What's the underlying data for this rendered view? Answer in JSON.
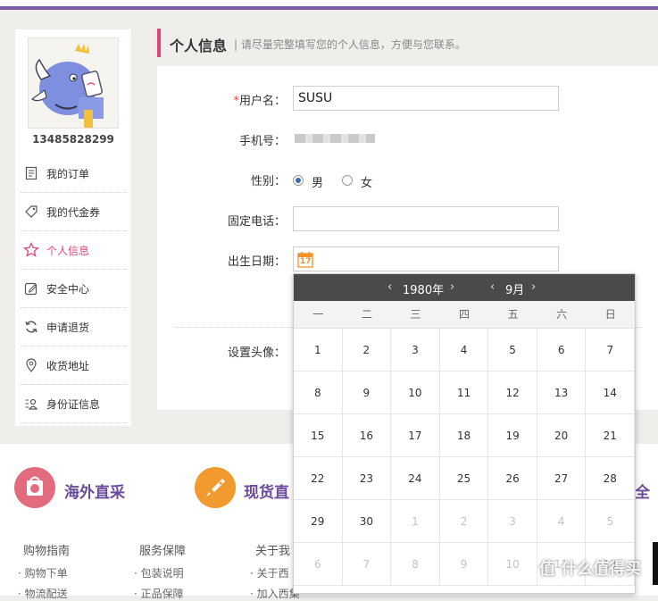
{
  "profile": {
    "phone": "13485828299"
  },
  "sidebar": {
    "items": [
      {
        "label": "我的订单",
        "icon": "order-icon"
      },
      {
        "label": "我的代金券",
        "icon": "coupon-icon"
      },
      {
        "label": "个人信息",
        "icon": "star-icon",
        "active": true
      },
      {
        "label": "安全中心",
        "icon": "edit-icon"
      },
      {
        "label": "申请退货",
        "icon": "refresh-icon"
      },
      {
        "label": "收货地址",
        "icon": "location-icon"
      },
      {
        "label": "身份证信息",
        "icon": "id-card-icon"
      }
    ]
  },
  "header": {
    "title": "个人信息",
    "subtitle": "| 请尽量完整填写您的个人信息，方便与您联系。"
  },
  "form": {
    "username_label": "用户名：",
    "username_required": "*",
    "username_value": "SUSU",
    "phone_label": "手机号：",
    "gender_label": "性别：",
    "gender_male": "男",
    "gender_female": "女",
    "landline_label": "固定电话：",
    "birthday_label": "出生日期：",
    "calendar_icon_text": "17",
    "avatar_label": "设置头像："
  },
  "calendar": {
    "year": "1980年",
    "month": "9月",
    "weekdays": [
      "一",
      "二",
      "三",
      "四",
      "五",
      "六",
      "日"
    ],
    "weeks": [
      [
        {
          "d": "1"
        },
        {
          "d": "2"
        },
        {
          "d": "3"
        },
        {
          "d": "4"
        },
        {
          "d": "5"
        },
        {
          "d": "6"
        },
        {
          "d": "7"
        }
      ],
      [
        {
          "d": "8"
        },
        {
          "d": "9"
        },
        {
          "d": "10"
        },
        {
          "d": "11"
        },
        {
          "d": "12"
        },
        {
          "d": "13"
        },
        {
          "d": "14"
        }
      ],
      [
        {
          "d": "15"
        },
        {
          "d": "16"
        },
        {
          "d": "17"
        },
        {
          "d": "18"
        },
        {
          "d": "19"
        },
        {
          "d": "20"
        },
        {
          "d": "21"
        }
      ],
      [
        {
          "d": "22"
        },
        {
          "d": "23"
        },
        {
          "d": "24"
        },
        {
          "d": "25"
        },
        {
          "d": "26"
        },
        {
          "d": "27"
        },
        {
          "d": "28"
        }
      ],
      [
        {
          "d": "29"
        },
        {
          "d": "30"
        },
        {
          "d": "1",
          "other": true
        },
        {
          "d": "2",
          "other": true
        },
        {
          "d": "3",
          "other": true
        },
        {
          "d": "4",
          "other": true
        },
        {
          "d": "5",
          "other": true
        }
      ],
      [
        {
          "d": "6",
          "other": true
        },
        {
          "d": "7",
          "other": true
        },
        {
          "d": "8",
          "other": true
        },
        {
          "d": "9",
          "other": true
        },
        {
          "d": "10",
          "other": true
        },
        {
          "d": "11",
          "other": true
        },
        {
          "d": "12",
          "other": true
        }
      ]
    ]
  },
  "footer": {
    "feature1": "海外直采",
    "feature2": "现货直",
    "feature3": "全",
    "col1_title": "购物指南",
    "col1_items": [
      "· 购物下单",
      "· 物流配送"
    ],
    "col2_title": "服务保障",
    "col2_items": [
      "· 包装说明",
      "· 正品保障"
    ],
    "col3_title": "关于我",
    "col3_items": [
      "· 关于西",
      "· 加入西集"
    ],
    "watermark": "值 什么值得买"
  },
  "colors": {
    "accent": "#e0457a",
    "brand": "#7a5aa6",
    "calendar_header": "#4a4a4a"
  }
}
